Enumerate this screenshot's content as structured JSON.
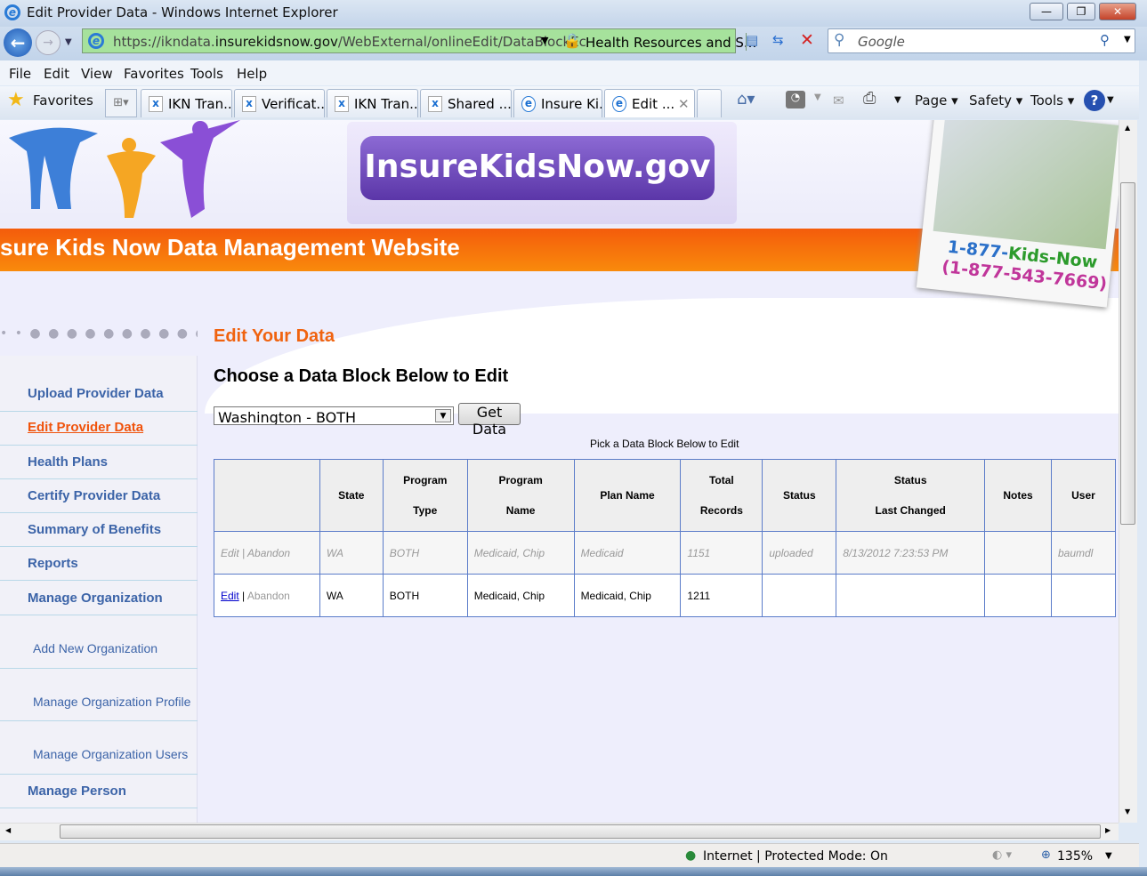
{
  "window": {
    "title": "Edit Provider Data - Windows Internet Explorer"
  },
  "address": {
    "url_prefix": "https://",
    "url_domain_pre": "ikndata.",
    "url_domain": "insurekidsnow.gov",
    "url_path": "/WebExternal/onlineEdit/DataBlockEc",
    "cert": "Health Resources and S..."
  },
  "search": {
    "placeholder": "Google"
  },
  "menu": [
    "File",
    "Edit",
    "View",
    "Favorites",
    "Tools",
    "Help"
  ],
  "favorites_label": "Favorites",
  "tabs": [
    "IKN Tran...",
    "Verificat...",
    "IKN Tran...",
    "Shared ...",
    "Insure Ki...",
    "Edit ..."
  ],
  "toolbar": {
    "page": "Page",
    "safety": "Safety",
    "tools": "Tools"
  },
  "banner": {
    "logo": "InsureKidsNow.gov",
    "site_title": "sure Kids Now Data Management Website",
    "phone1_a": "1-877-",
    "phone1_b": "Kids-Now",
    "phone2": "(1-877-543-7669)"
  },
  "sidebar": {
    "items": [
      "Upload Provider Data",
      "Edit Provider Data",
      "Health Plans",
      "Certify Provider Data",
      "Summary of Benefits",
      "Reports",
      "Manage Organization",
      "Add New Organization",
      "Manage Organization Profile",
      "Manage Organization Users",
      "Manage Person"
    ]
  },
  "main": {
    "title": "Edit Your Data",
    "subtitle": "Choose a Data Block Below to Edit",
    "select_value": "Washington - BOTH",
    "get_data": "Get Data",
    "caption": "Pick a Data Block Below to Edit"
  },
  "table": {
    "headers": [
      [
        "",
        ""
      ],
      [
        "State",
        ""
      ],
      [
        "Program",
        "Type"
      ],
      [
        "Program",
        "Name"
      ],
      [
        "Plan Name",
        ""
      ],
      [
        "Total",
        "Records"
      ],
      [
        "Status",
        ""
      ],
      [
        "Status",
        "Last Changed"
      ],
      [
        "Notes",
        ""
      ],
      [
        "User",
        ""
      ]
    ],
    "rows": [
      {
        "edit": "Edit",
        "abandon": "Abandon",
        "state": "WA",
        "type": "BOTH",
        "program": "Medicaid, Chip",
        "plan": "Medicaid",
        "records": "1151",
        "status": "uploaded",
        "changed": "8/13/2012 7:23:53 PM",
        "notes": "",
        "user": "baumdl"
      },
      {
        "edit": "Edit",
        "abandon": "Abandon",
        "state": "WA",
        "type": "BOTH",
        "program": "Medicaid, Chip",
        "plan": "Medicaid, Chip",
        "records": "1211",
        "status": "",
        "changed": "",
        "notes": "",
        "user": ""
      }
    ]
  },
  "status": {
    "zone": "Internet | Protected Mode: On",
    "zoom": "135%"
  }
}
